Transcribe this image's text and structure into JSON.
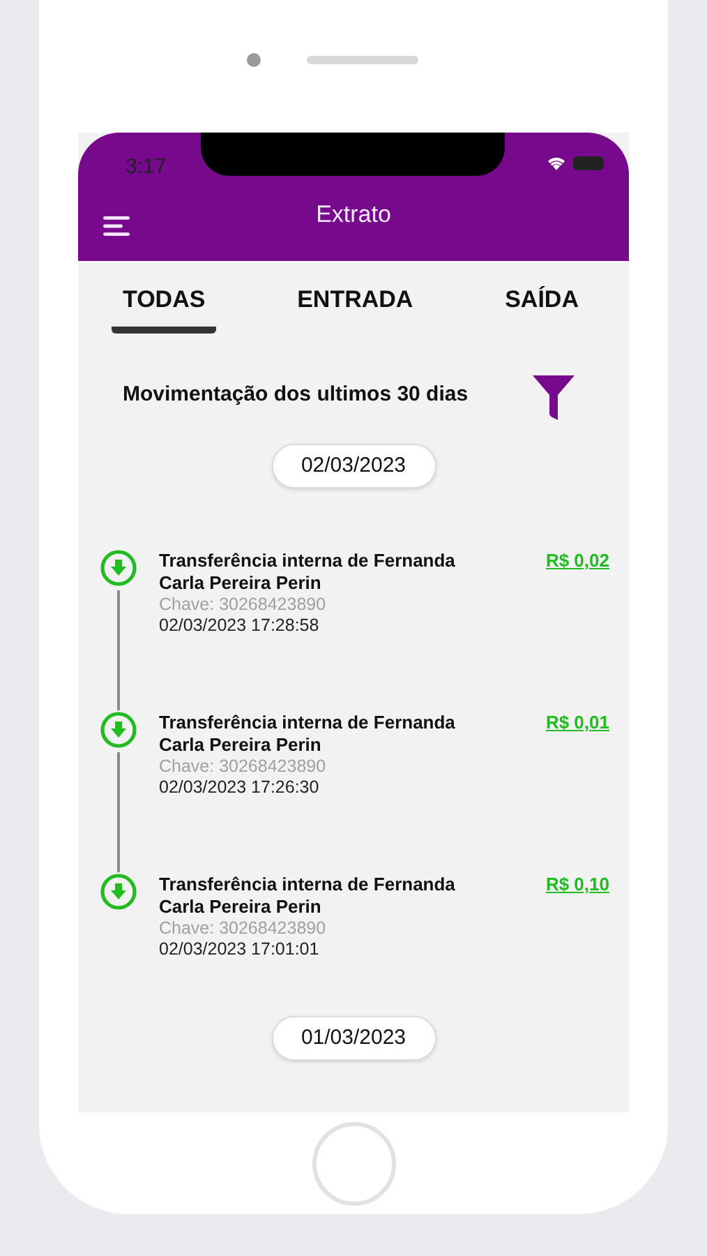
{
  "status_bar": {
    "time": "3:17"
  },
  "header": {
    "title": "Extrato"
  },
  "tabs": [
    {
      "label": "TODAS",
      "selected": true
    },
    {
      "label": "ENTRADA",
      "selected": false
    },
    {
      "label": "SAÍDA",
      "selected": false
    }
  ],
  "section_title": "Movimentação dos ultimos 30 dias",
  "groups": [
    {
      "date": "02/03/2023",
      "transactions": [
        {
          "title": "Transferência interna de Fernanda Carla Pereira Perin",
          "key": "Chave: 30268423890",
          "datetime": "02/03/2023 17:28:58",
          "amount": "R$ 0,02"
        },
        {
          "title": "Transferência interna de Fernanda Carla Pereira Perin",
          "key": "Chave: 30268423890",
          "datetime": "02/03/2023 17:26:30",
          "amount": "R$ 0,01"
        },
        {
          "title": "Transferência interna de Fernanda Carla Pereira Perin",
          "key": "Chave: 30268423890",
          "datetime": "02/03/2023 17:01:01",
          "amount": "R$ 0,10"
        }
      ]
    },
    {
      "date": "01/03/2023"
    }
  ]
}
